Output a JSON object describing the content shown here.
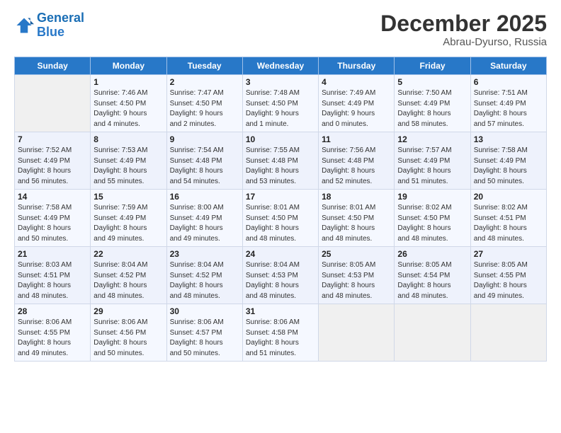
{
  "header": {
    "logo_line1": "General",
    "logo_line2": "Blue",
    "main_title": "December 2025",
    "sub_title": "Abrau-Dyurso, Russia"
  },
  "weekdays": [
    "Sunday",
    "Monday",
    "Tuesday",
    "Wednesday",
    "Thursday",
    "Friday",
    "Saturday"
  ],
  "weeks": [
    [
      {
        "day": "",
        "info": ""
      },
      {
        "day": "1",
        "info": "Sunrise: 7:46 AM\nSunset: 4:50 PM\nDaylight: 9 hours\nand 4 minutes."
      },
      {
        "day": "2",
        "info": "Sunrise: 7:47 AM\nSunset: 4:50 PM\nDaylight: 9 hours\nand 2 minutes."
      },
      {
        "day": "3",
        "info": "Sunrise: 7:48 AM\nSunset: 4:50 PM\nDaylight: 9 hours\nand 1 minute."
      },
      {
        "day": "4",
        "info": "Sunrise: 7:49 AM\nSunset: 4:49 PM\nDaylight: 9 hours\nand 0 minutes."
      },
      {
        "day": "5",
        "info": "Sunrise: 7:50 AM\nSunset: 4:49 PM\nDaylight: 8 hours\nand 58 minutes."
      },
      {
        "day": "6",
        "info": "Sunrise: 7:51 AM\nSunset: 4:49 PM\nDaylight: 8 hours\nand 57 minutes."
      }
    ],
    [
      {
        "day": "7",
        "info": "Sunrise: 7:52 AM\nSunset: 4:49 PM\nDaylight: 8 hours\nand 56 minutes."
      },
      {
        "day": "8",
        "info": "Sunrise: 7:53 AM\nSunset: 4:49 PM\nDaylight: 8 hours\nand 55 minutes."
      },
      {
        "day": "9",
        "info": "Sunrise: 7:54 AM\nSunset: 4:48 PM\nDaylight: 8 hours\nand 54 minutes."
      },
      {
        "day": "10",
        "info": "Sunrise: 7:55 AM\nSunset: 4:48 PM\nDaylight: 8 hours\nand 53 minutes."
      },
      {
        "day": "11",
        "info": "Sunrise: 7:56 AM\nSunset: 4:48 PM\nDaylight: 8 hours\nand 52 minutes."
      },
      {
        "day": "12",
        "info": "Sunrise: 7:57 AM\nSunset: 4:49 PM\nDaylight: 8 hours\nand 51 minutes."
      },
      {
        "day": "13",
        "info": "Sunrise: 7:58 AM\nSunset: 4:49 PM\nDaylight: 8 hours\nand 50 minutes."
      }
    ],
    [
      {
        "day": "14",
        "info": "Sunrise: 7:58 AM\nSunset: 4:49 PM\nDaylight: 8 hours\nand 50 minutes."
      },
      {
        "day": "15",
        "info": "Sunrise: 7:59 AM\nSunset: 4:49 PM\nDaylight: 8 hours\nand 49 minutes."
      },
      {
        "day": "16",
        "info": "Sunrise: 8:00 AM\nSunset: 4:49 PM\nDaylight: 8 hours\nand 49 minutes."
      },
      {
        "day": "17",
        "info": "Sunrise: 8:01 AM\nSunset: 4:50 PM\nDaylight: 8 hours\nand 48 minutes."
      },
      {
        "day": "18",
        "info": "Sunrise: 8:01 AM\nSunset: 4:50 PM\nDaylight: 8 hours\nand 48 minutes."
      },
      {
        "day": "19",
        "info": "Sunrise: 8:02 AM\nSunset: 4:50 PM\nDaylight: 8 hours\nand 48 minutes."
      },
      {
        "day": "20",
        "info": "Sunrise: 8:02 AM\nSunset: 4:51 PM\nDaylight: 8 hours\nand 48 minutes."
      }
    ],
    [
      {
        "day": "21",
        "info": "Sunrise: 8:03 AM\nSunset: 4:51 PM\nDaylight: 8 hours\nand 48 minutes."
      },
      {
        "day": "22",
        "info": "Sunrise: 8:04 AM\nSunset: 4:52 PM\nDaylight: 8 hours\nand 48 minutes."
      },
      {
        "day": "23",
        "info": "Sunrise: 8:04 AM\nSunset: 4:52 PM\nDaylight: 8 hours\nand 48 minutes."
      },
      {
        "day": "24",
        "info": "Sunrise: 8:04 AM\nSunset: 4:53 PM\nDaylight: 8 hours\nand 48 minutes."
      },
      {
        "day": "25",
        "info": "Sunrise: 8:05 AM\nSunset: 4:53 PM\nDaylight: 8 hours\nand 48 minutes."
      },
      {
        "day": "26",
        "info": "Sunrise: 8:05 AM\nSunset: 4:54 PM\nDaylight: 8 hours\nand 48 minutes."
      },
      {
        "day": "27",
        "info": "Sunrise: 8:05 AM\nSunset: 4:55 PM\nDaylight: 8 hours\nand 49 minutes."
      }
    ],
    [
      {
        "day": "28",
        "info": "Sunrise: 8:06 AM\nSunset: 4:55 PM\nDaylight: 8 hours\nand 49 minutes."
      },
      {
        "day": "29",
        "info": "Sunrise: 8:06 AM\nSunset: 4:56 PM\nDaylight: 8 hours\nand 50 minutes."
      },
      {
        "day": "30",
        "info": "Sunrise: 8:06 AM\nSunset: 4:57 PM\nDaylight: 8 hours\nand 50 minutes."
      },
      {
        "day": "31",
        "info": "Sunrise: 8:06 AM\nSunset: 4:58 PM\nDaylight: 8 hours\nand 51 minutes."
      },
      {
        "day": "",
        "info": ""
      },
      {
        "day": "",
        "info": ""
      },
      {
        "day": "",
        "info": ""
      }
    ]
  ]
}
